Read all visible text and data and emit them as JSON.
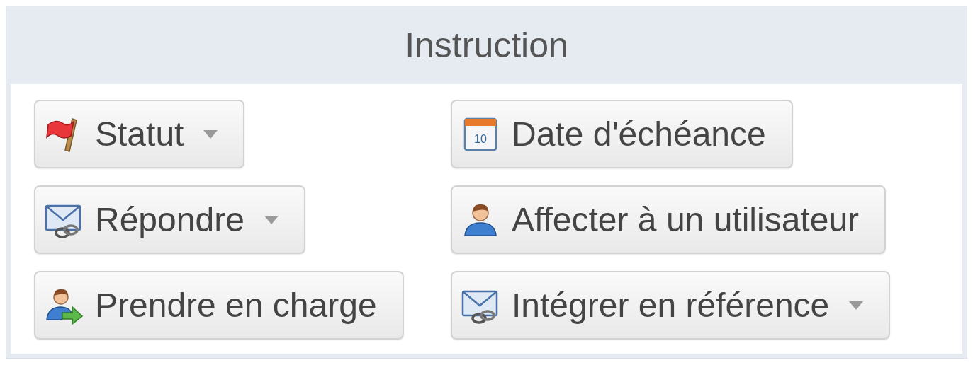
{
  "panel": {
    "title": "Instruction"
  },
  "buttons": [
    {
      "label": "Statut",
      "kind": "flag",
      "dropdown": true
    },
    {
      "label": "Date d'échéance",
      "kind": "calendar",
      "icon_text": "10",
      "dropdown": false
    },
    {
      "label": "Répondre",
      "kind": "mail",
      "dropdown": true
    },
    {
      "label": "Affecter à un utilisateur",
      "kind": "person",
      "dropdown": false
    },
    {
      "label": "Prendre en charge",
      "kind": "takeover",
      "dropdown": false
    },
    {
      "label": "Intégrer en référence",
      "kind": "mail",
      "dropdown": true
    }
  ]
}
